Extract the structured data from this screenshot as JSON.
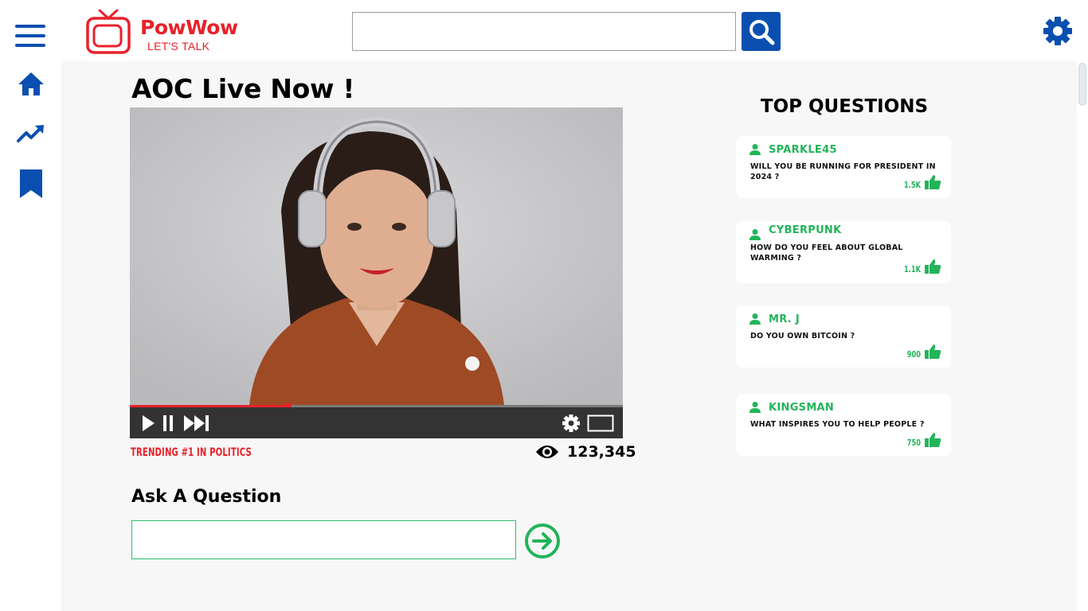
{
  "app": {
    "brand": "PowWow",
    "tagline": "LET'S TALK"
  },
  "search": {
    "value": "",
    "placeholder": ""
  },
  "nav": {
    "items": [
      {
        "icon": "home-icon"
      },
      {
        "icon": "trending-icon"
      },
      {
        "icon": "bookmark-icon"
      }
    ]
  },
  "stream": {
    "title": "AOC Live Now !",
    "trending": "TRENDING #1  IN POLITICS",
    "views": "123,345",
    "progress_fraction": 0.32
  },
  "ask": {
    "title": "Ask A Question",
    "value": "",
    "placeholder": ""
  },
  "top_questions": {
    "title": "TOP QUESTIONS",
    "items": [
      {
        "user": "SPARKLE45",
        "question": "WILL YOU BE RUNNING FOR PRESIDENT IN 2024 ?",
        "likes": "1.5K"
      },
      {
        "user": "CYBERPUNK",
        "question": "HOW DO YOU FEEL ABOUT GLOBAL WARMING ?",
        "likes": "1.1K"
      },
      {
        "user": "MR. J",
        "question": "DO YOU OWN BITCOIN ?",
        "likes": "900"
      },
      {
        "user": "KINGSMAN",
        "question": "WHAT INSPIRES YOU TO HELP PEOPLE ?",
        "likes": "750"
      }
    ]
  },
  "colors": {
    "brand_red": "#e8212a",
    "nav_blue": "#0a4fb0",
    "accent_green": "#23b45a"
  }
}
